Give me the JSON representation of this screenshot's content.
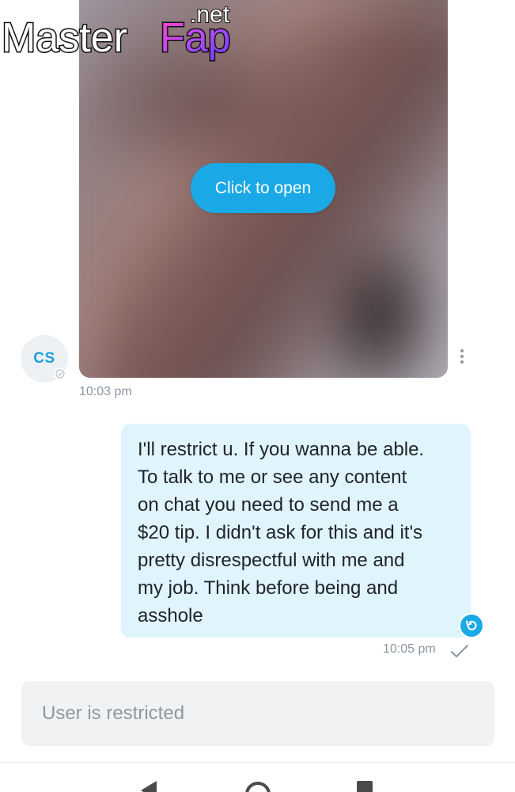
{
  "watermark": {
    "brand": "MasterFap",
    "suffix": ".net"
  },
  "media": {
    "open_label": "Click to open"
  },
  "received": {
    "avatar_initials": "CS",
    "time": "10:03 pm"
  },
  "sent": {
    "text": "I'll restrict u. If you wanna be able.\nTo talk to me or see any content\non chat you need to send me a\n$20 tip. I didn't ask for this and it's\npretty disrespectful with me and\nmy job. Think before being and\nasshole",
    "time": "10:05 pm"
  },
  "composer": {
    "restricted_text": "User is restricted"
  },
  "icons": {
    "more": "more-vertical-icon",
    "undo": "undo-icon",
    "check": "check-icon",
    "badge": "verified-badge-icon"
  },
  "colors": {
    "accent": "#1aa9e6",
    "bubble": "#dff4fd",
    "muted_text": "#8a96a3",
    "restricted_bg": "#f1f2f4"
  }
}
